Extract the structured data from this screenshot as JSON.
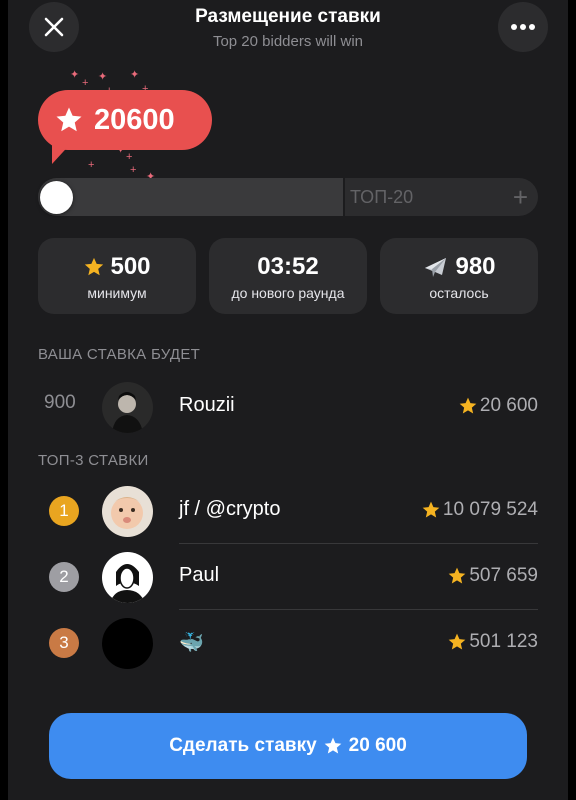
{
  "header": {
    "title": "Размещение ставки",
    "subtitle": "Top 20 bidders will win"
  },
  "bubble": {
    "value": "20600"
  },
  "slider": {
    "label": "ТОП-20",
    "plus": "+",
    "position_fraction": 0.0
  },
  "stats": [
    {
      "value": "500",
      "label": "минимум",
      "icon": "star-icon"
    },
    {
      "value": "03:52",
      "label": "до нового раунда"
    },
    {
      "value": "980",
      "label": "осталось",
      "icon": "gift-icon"
    }
  ],
  "your_bid": {
    "section_title": "ВАША СТАВКА БУДЕТ",
    "rank": "900",
    "name": "Rouzii",
    "amount": "20 600"
  },
  "top3": {
    "section_title": "ТОП-3 СТАВКИ",
    "rows": [
      {
        "rank": "1",
        "name": "jf / @crypto",
        "amount": "10 079 524",
        "medal_color": "#e9a520"
      },
      {
        "rank": "2",
        "name": "Paul",
        "amount": "507 659",
        "medal_color": "#9e9ea3"
      },
      {
        "rank": "3",
        "name": "🐳",
        "amount": "501 123",
        "medal_color": "#c97a45"
      }
    ]
  },
  "cta": {
    "label": "Сделать ставку",
    "amount": "20 600"
  },
  "colors": {
    "accent": "#3e8cf0",
    "bubble": "#e8504f",
    "star": "#f5b321"
  }
}
